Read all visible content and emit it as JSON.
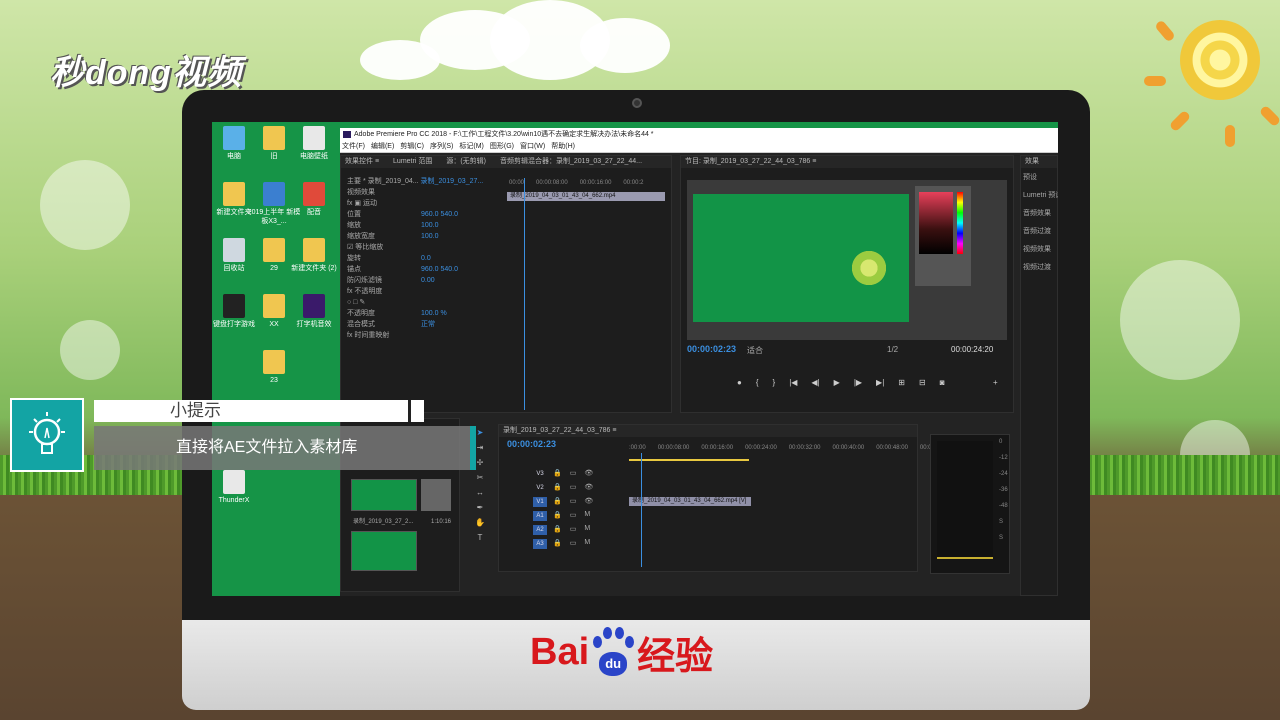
{
  "watermark": {
    "text": "秒dong视频"
  },
  "desktop": {
    "icons": [
      {
        "label": "电脑",
        "color": "#5ab0e8"
      },
      {
        "label": "旧",
        "color": "#f0c650"
      },
      {
        "label": "电脑壁纸",
        "color": "#e8e8e8"
      },
      {
        "label": "新建文件夹",
        "color": "#f0c650"
      },
      {
        "label": "2019上半年 新模板X3_...",
        "color": "#3b7fd0"
      },
      {
        "label": "配音",
        "color": "#e04a3a"
      },
      {
        "label": "回收站",
        "color": "#cfd8e0"
      },
      {
        "label": "29",
        "color": "#f0c650"
      },
      {
        "label": "新建文件夹 (2)",
        "color": "#f0c650"
      },
      {
        "label": "键盘打字游戏",
        "color": "#222222"
      },
      {
        "label": "XX",
        "color": "#f0c650"
      },
      {
        "label": "打字机音效",
        "color": "#3a1a6a"
      },
      {
        "label": "23",
        "color": "#f0c650"
      },
      {
        "label": "ThunderX",
        "color": "#e8e8e8"
      }
    ]
  },
  "premiere": {
    "title": "Adobe Premiere Pro CC 2018 - F:\\工作\\工程文件\\3.20\\win10遇不去确定求生解决办法\\未命名44 *",
    "menu": [
      "文件(F)",
      "编辑(E)",
      "剪辑(C)",
      "序列(S)",
      "标记(M)",
      "图形(G)",
      "窗口(W)",
      "帮助(H)"
    ],
    "effect_controls": {
      "tabs": [
        "效果控件 ≡",
        "Lumetri 范围",
        "源：(无剪辑)",
        "音频剪辑混合器：录制_2019_03_27_22_44..."
      ],
      "master": "主要 * 录制_2019_04...",
      "sequence": "录制_2019_03_27...",
      "timecodes": [
        "00:00",
        "00:00:08:00",
        "00:00:16:00",
        "00:00:2"
      ],
      "clip_label": "录制_2019_04_03_01_43_04_662.mp4",
      "rows": [
        {
          "label": "视频效果",
          "value": ""
        },
        {
          "label": "fx ▣ 运动",
          "value": ""
        },
        {
          "label": "位置",
          "value": "960.0     540.0"
        },
        {
          "label": "缩放",
          "value": "100.0"
        },
        {
          "label": "缩放宽度",
          "value": "100.0"
        },
        {
          "label": "☑ 等比缩放",
          "value": ""
        },
        {
          "label": "旋转",
          "value": "0.0"
        },
        {
          "label": "锚点",
          "value": "960.0     540.0"
        },
        {
          "label": "防闪烁滤镜",
          "value": "0.00"
        },
        {
          "label": "fx 不透明度",
          "value": ""
        },
        {
          "label": "○ □ ✎",
          "value": ""
        },
        {
          "label": "不透明度",
          "value": "100.0 %"
        },
        {
          "label": "混合模式",
          "value": "正常"
        },
        {
          "label": "fx 时间重映射",
          "value": ""
        }
      ]
    },
    "program": {
      "tab": "节目: 录制_2019_03_27_22_44_03_786  ≡",
      "timecode": "00:00:02:23",
      "fit": "适合",
      "ratio": "1/2",
      "duration": "00:00:24:20"
    },
    "effects_panel": {
      "title": "效果",
      "items": [
        "预设",
        "Lumetri 预设",
        "音频效果",
        "音频过渡",
        "视频效果",
        "视频过渡"
      ]
    },
    "timeline": {
      "tab": "录制_2019_03_27_22_44_03_786  ≡",
      "timecode": "00:00:02:23",
      "ruler": [
        ":00:00",
        "00:00:08:00",
        "00:00:16:00",
        "00:00:24:00",
        "00:00:32:00",
        "00:00:40:00",
        "00:00:48:00",
        "00:0"
      ],
      "tracks": [
        "V3",
        "V2",
        "V1",
        "A1",
        "A2",
        "A3"
      ],
      "clip": "录制_2019_04_03_01_43_04_662.mp4 [V]"
    },
    "project": {
      "item": "录制_2019_03_27_2...",
      "duration": "1:10:16"
    },
    "meter_labels": [
      "0",
      "-12",
      "-24",
      "-36",
      "-48",
      "S",
      "S"
    ]
  },
  "tip": {
    "heading": "小提示",
    "text": "直接将AE文件拉入素材库",
    "accent": "#13a4a4"
  },
  "brand": {
    "text": "经验",
    "bai": "Bai",
    "du": "du"
  }
}
